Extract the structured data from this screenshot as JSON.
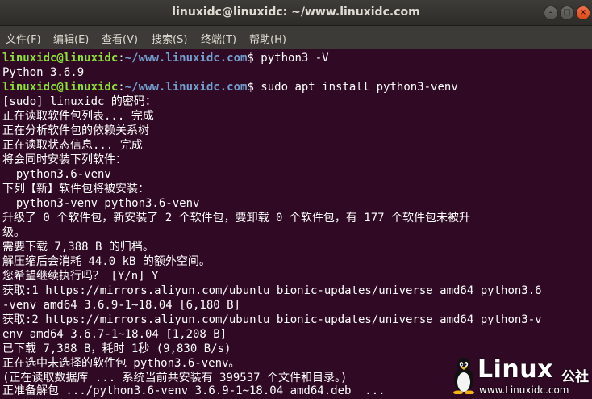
{
  "window": {
    "title": "linuxidc@linuxidc: ~/www.linuxidc.com",
    "minimize_glyph": "–",
    "maximize_glyph": "□",
    "close_glyph": "×"
  },
  "menu": {
    "items": [
      "文件(F)",
      "编辑(E)",
      "查看(V)",
      "搜索(S)",
      "终端(T)",
      "帮助(H)"
    ]
  },
  "colors": {
    "terminal_bg": "#300a24",
    "prompt_user": "#8ae234",
    "prompt_path": "#729fcf",
    "text": "#ffffff"
  },
  "terminal": {
    "lines": [
      {
        "prompt_user": "linuxidc@linuxidc",
        "prompt_sep": ":",
        "prompt_path": "~/www.linuxidc.com",
        "text": "$ python3 -V"
      },
      {
        "text": "Python 3.6.9"
      },
      {
        "prompt_user": "linuxidc@linuxidc",
        "prompt_sep": ":",
        "prompt_path": "~/www.linuxidc.com",
        "text": "$ sudo apt install python3-venv"
      },
      {
        "text": "[sudo] linuxidc 的密码："
      },
      {
        "text": "正在读取软件包列表... 完成"
      },
      {
        "text": "正在分析软件包的依赖关系树"
      },
      {
        "text": "正在读取状态信息... 完成"
      },
      {
        "text": "将会同时安装下列软件："
      },
      {
        "text": "  python3.6-venv"
      },
      {
        "text": "下列【新】软件包将被安装："
      },
      {
        "text": "  python3-venv python3.6-venv"
      },
      {
        "text": "升级了 0 个软件包，新安装了 2 个软件包，要卸载 0 个软件包，有 177 个软件包未被升"
      },
      {
        "text": "级。"
      },
      {
        "text": "需要下载 7,388 B 的归档。"
      },
      {
        "text": "解压缩后会消耗 44.0 kB 的额外空间。"
      },
      {
        "text": "您希望继续执行吗？ [Y/n] Y"
      },
      {
        "text": "获取:1 https://mirrors.aliyun.com/ubuntu bionic-updates/universe amd64 python3.6"
      },
      {
        "text": "-venv amd64 3.6.9-1~18.04 [6,180 B]"
      },
      {
        "text": "获取:2 https://mirrors.aliyun.com/ubuntu bionic-updates/universe amd64 python3-v"
      },
      {
        "text": "env amd64 3.6.7-1~18.04 [1,208 B]"
      },
      {
        "text": "已下载 7,388 B，耗时 1秒 (9,830 B/s)"
      },
      {
        "text": "正在选中未选择的软件包 python3.6-venv。"
      },
      {
        "text": "(正在读取数据库 ... 系统当前共安装有 399537 个文件和目录。)"
      },
      {
        "text": "正准备解包 .../python3.6-venv_3.6.9-1~18.04_amd64.deb  ..."
      }
    ]
  },
  "watermark": {
    "brand": "Linux",
    "suffix": "公社",
    "site": "www.Linuxidc.com",
    "icon": "tux-penguin-icon"
  }
}
